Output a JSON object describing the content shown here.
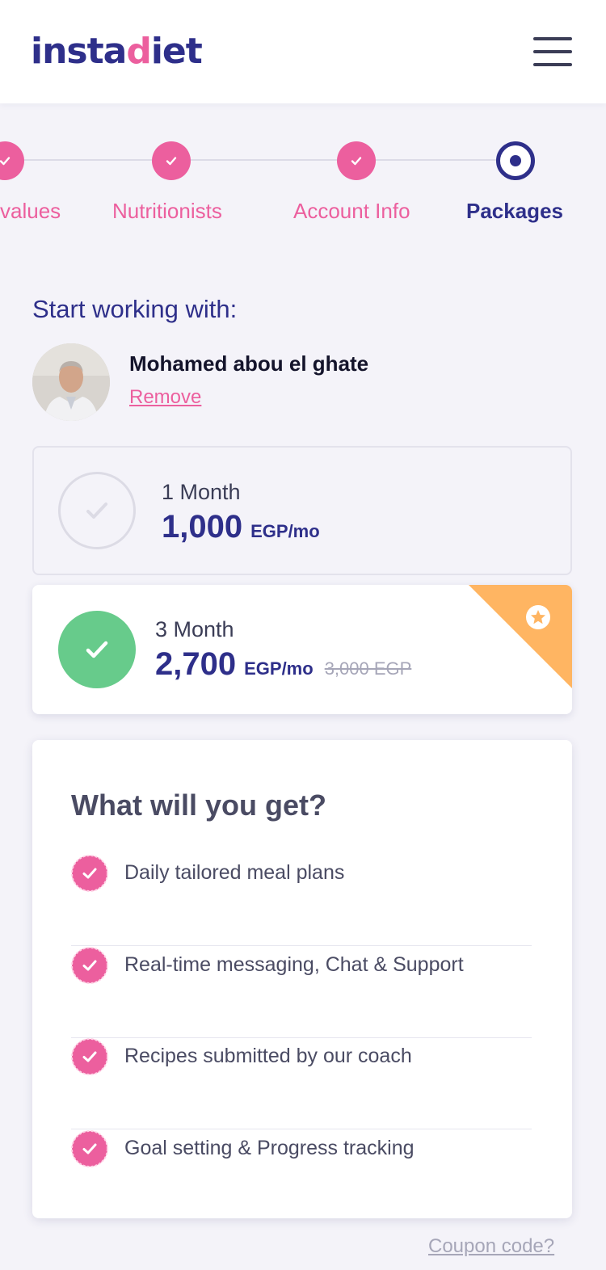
{
  "brand": {
    "logo_pre": "insta",
    "logo_accent": "d",
    "logo_post": "iet",
    "primary_color": "#2e2f8a",
    "accent_color": "#ec5f9e",
    "success_color": "#67cb8b",
    "ribbon_color": "#ffb562"
  },
  "header": {
    "menu_icon": "hamburger-menu-icon"
  },
  "stepper": {
    "steps": [
      {
        "label": "values",
        "status": "completed"
      },
      {
        "label": "Nutritionists",
        "status": "completed"
      },
      {
        "label": "Account Info",
        "status": "completed"
      },
      {
        "label": "Packages",
        "status": "current"
      }
    ]
  },
  "selection": {
    "title": "Start working with:",
    "nutritionist_name": "Mohamed abou el ghate",
    "remove_label": "Remove"
  },
  "plans": [
    {
      "duration": "1 Month",
      "price": "1,000",
      "unit": "EGP/mo",
      "old_price": "",
      "selected": false
    },
    {
      "duration": "3 Month",
      "price": "2,700",
      "unit": "EGP/mo",
      "old_price": "3,000 EGP",
      "selected": true,
      "badge_icon": "star-icon"
    }
  ],
  "benefits": {
    "title": "What will you get?",
    "items": [
      "Daily tailored meal plans",
      "Real-time messaging, Chat & Support",
      "Recipes submitted by our coach",
      "Goal setting & Progress tracking"
    ]
  },
  "coupon_label": "Coupon code?"
}
